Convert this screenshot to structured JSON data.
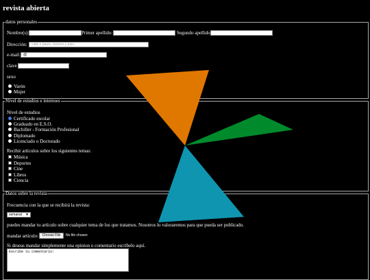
{
  "page_title": "revista abierta",
  "personal": {
    "legend": "datos personales",
    "nombre_label": "Nombre(s):",
    "primer_label": "Primer apellido:",
    "segundo_label": "Segundo apellido:",
    "direccion_label": "Dirección:",
    "direccion_placeholder": "calle o plaza, número y piso.",
    "email_label": "e-mail:",
    "email_value": "@",
    "clave_label": "clave",
    "sexo_label": "sexo",
    "sexo_options": [
      "Varón",
      "Mujer"
    ]
  },
  "estudios": {
    "legend": "Nivel de estudios e intereses",
    "nivel_label": "Nivel de estudios",
    "nivel_options": [
      "Certificado escolar",
      "Graduado en E.S.O.",
      "Bachiller - Formación Profesional",
      "Diplomado",
      "Licenciado o Doctorado"
    ],
    "nivel_selected": "Certificado escolar",
    "temas_label": "Recibir artículos sobre los siguientes temas:",
    "temas_options": [
      "Música",
      "Deportes",
      "Cine",
      "Libros",
      "Ciencia"
    ]
  },
  "revista": {
    "legend": "Datos sobre la revista",
    "frecuencia_label": "Frecuencia con la que se recibirá la revista:",
    "frecuencia_value": "semanal",
    "articulo_text": "puedes mandar tu artículo sobre cualquier tema de los que tratamos. Nosotros lo valoraremos para que pueda ser publicado.",
    "mandar_label": "mandar artículo:",
    "file_button": "Choose File",
    "file_status": "No file chosen",
    "comentario_label": "Si deseas mandar simplemente una opinion o comentario escríbelo aquí.",
    "comentario_value": "Escribe tu comentario:"
  },
  "colors": {
    "orange": "#e07800",
    "red": "#e03c10",
    "green": "#008a2c",
    "teal": "#0f95b0"
  }
}
